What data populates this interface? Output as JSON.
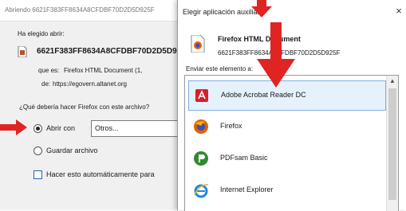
{
  "download_dialog": {
    "title": "Abriendo 6621F383FF8634A8CFDBF70D2D5D925F",
    "you_chose_label": "Ha elegido abrir:",
    "file_name": "6621F383FF8634A8CFDBF70D2D5D925F",
    "type_label": "que es:",
    "type_value": "Firefox HTML Document (1,",
    "from_label": "de:",
    "from_value": "https://egovern.altanet.org",
    "question": "¿Qué debería hacer Firefox con este archivo?",
    "open_with_label": "Abrir con",
    "open_with_value": "Otros...",
    "save_label": "Guardar archivo",
    "auto_label": "Hacer esto automáticamente para"
  },
  "chooser_dialog": {
    "title": "Elegir aplicación auxiliar",
    "file_title": "Firefox HTML Document",
    "file_id": "6621F383FF8634A8CFDBF70D2D5D925F",
    "send_label": "Enviar este elemento a:",
    "close_glyph": "×",
    "scroll_up_glyph": "▲",
    "apps": [
      {
        "name": "Adobe Acrobat Reader DC",
        "icon": "adobe-acrobat-icon",
        "selected": true
      },
      {
        "name": "Firefox",
        "icon": "firefox-icon",
        "selected": false
      },
      {
        "name": "PDFsam Basic",
        "icon": "pdfsam-icon",
        "selected": false
      },
      {
        "name": "Internet Explorer",
        "icon": "internet-explorer-icon",
        "selected": false
      }
    ]
  },
  "colors": {
    "arrow_red": "#e02424",
    "selection_bg": "#e5f1fb",
    "selection_border": "#7fb0e8"
  }
}
